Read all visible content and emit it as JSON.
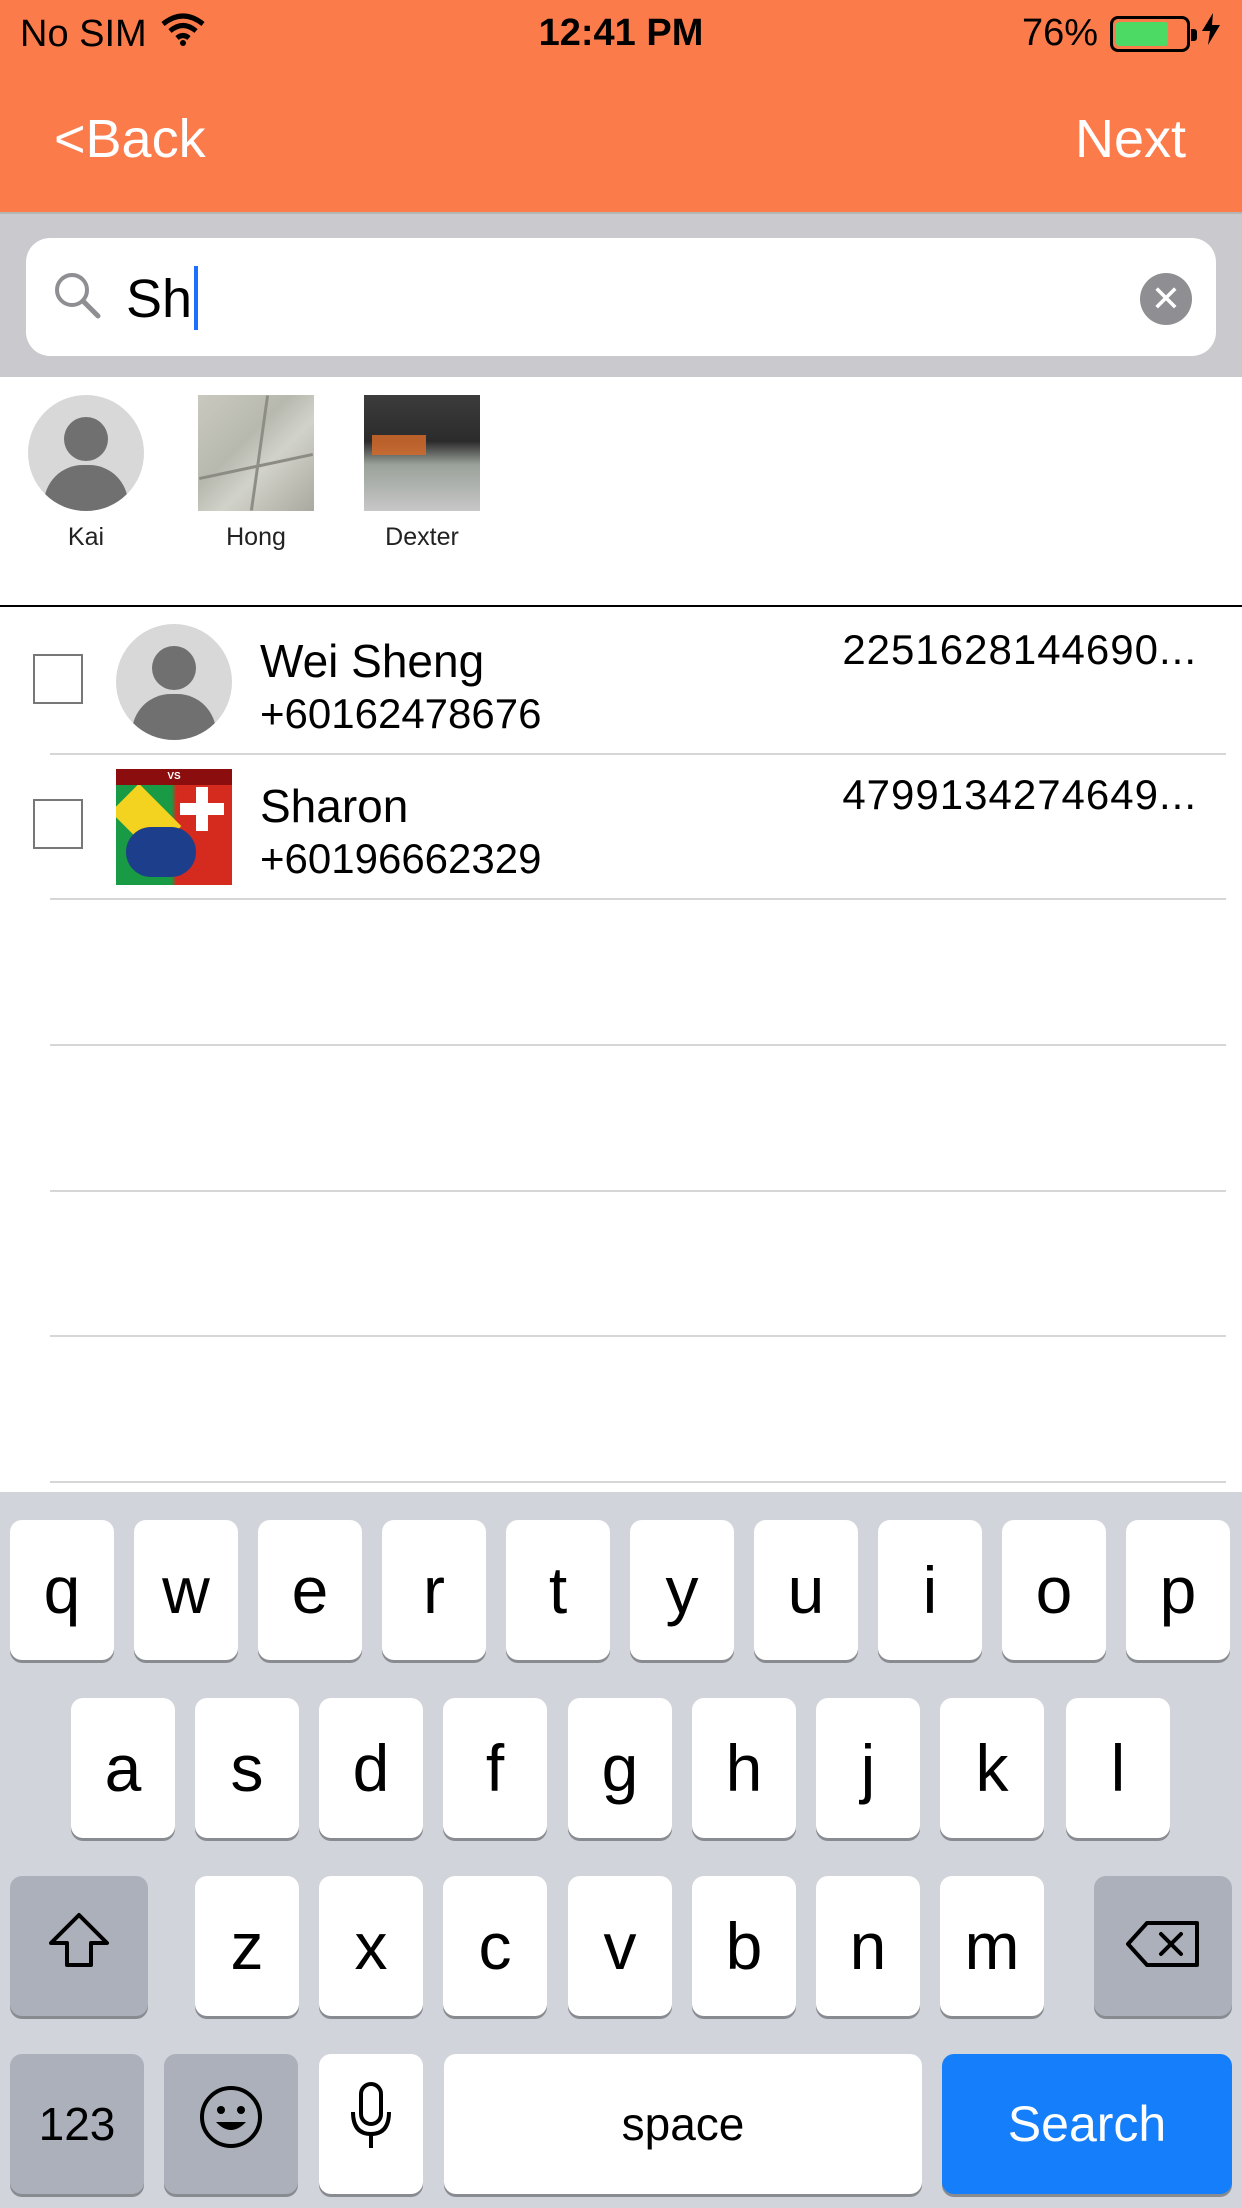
{
  "status": {
    "carrier": "No SIM",
    "time": "12:41 PM",
    "battery": "76%",
    "battery_level": 0.76
  },
  "nav": {
    "back": "<Back",
    "next": "Next",
    "accent": "#FC7B4B"
  },
  "search": {
    "query": "Sh"
  },
  "selected": [
    {
      "name": "Kai"
    },
    {
      "name": "Hong"
    },
    {
      "name": "Dexter"
    }
  ],
  "contacts": [
    {
      "name": "Wei Sheng",
      "phone": "+60162478676",
      "code": "2251628144690..."
    },
    {
      "name": "Sharon",
      "phone": "+60196662329",
      "code": "4799134274649..."
    }
  ],
  "keyboard": {
    "row1": [
      "q",
      "w",
      "e",
      "r",
      "t",
      "y",
      "u",
      "i",
      "o",
      "p"
    ],
    "row2": [
      "a",
      "s",
      "d",
      "f",
      "g",
      "h",
      "j",
      "k",
      "l"
    ],
    "row3": [
      "z",
      "x",
      "c",
      "v",
      "b",
      "n",
      "m"
    ],
    "numbers": "123",
    "space": "space",
    "search": "Search",
    "search_color": "#147EFB"
  },
  "icons": [
    "wifi-icon",
    "battery-icon",
    "charging-icon",
    "search-icon",
    "clear-icon",
    "person-icon",
    "shift-icon",
    "backspace-icon",
    "emoji-icon",
    "mic-icon"
  ]
}
